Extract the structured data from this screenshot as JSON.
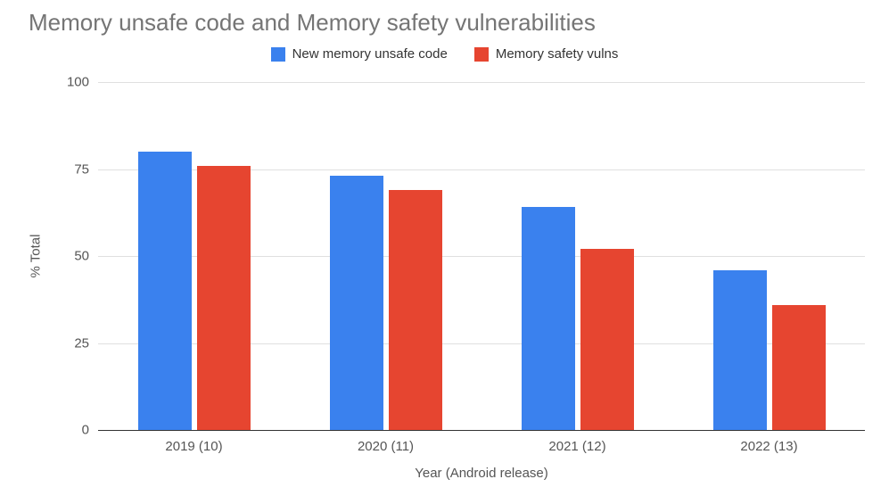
{
  "chart_data": {
    "type": "bar",
    "title": "Memory unsafe code and Memory safety vulnerabilities",
    "xlabel": "Year (Android release)",
    "ylabel": "% Total",
    "ylim": [
      0,
      100
    ],
    "yticks": [
      0,
      25,
      50,
      75,
      100
    ],
    "categories": [
      "2019 (10)",
      "2020 (11)",
      "2021 (12)",
      "2022 (13)"
    ],
    "series": [
      {
        "name": "New memory unsafe code",
        "color": "#3a81ee",
        "values": [
          80,
          73,
          64,
          46
        ]
      },
      {
        "name": "Memory safety vulns",
        "color": "#e64530",
        "values": [
          76,
          69,
          52,
          36
        ]
      }
    ],
    "legend_position": "top"
  }
}
